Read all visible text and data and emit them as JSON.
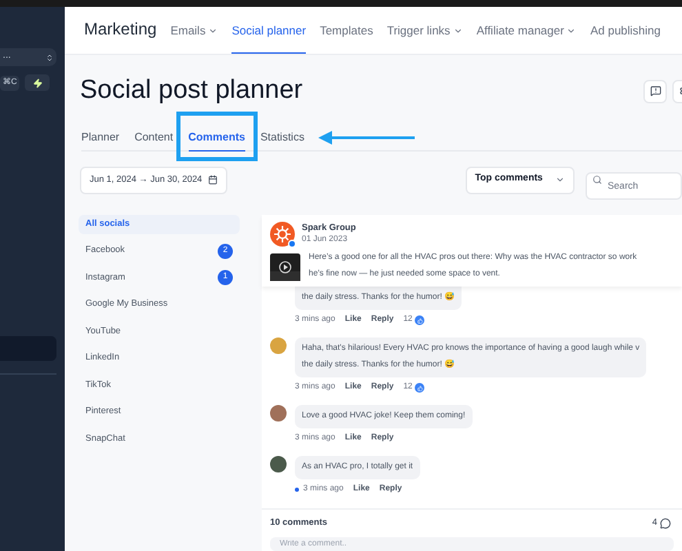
{
  "sidebar": {
    "workspace_field": {
      "value": "..."
    },
    "shortcut": "⌘C"
  },
  "nav": {
    "title": "Marketing",
    "items": [
      {
        "label": "Emails",
        "dropdown": true,
        "selected": false
      },
      {
        "label": "Social planner",
        "dropdown": false,
        "selected": true
      },
      {
        "label": "Templates",
        "dropdown": false,
        "selected": false
      },
      {
        "label": "Trigger links",
        "dropdown": true,
        "selected": false
      },
      {
        "label": "Affiliate manager",
        "dropdown": true,
        "selected": false
      },
      {
        "label": "Ad publishing",
        "dropdown": false,
        "selected": false
      }
    ]
  },
  "page": {
    "title": "Social post planner"
  },
  "tabs": [
    {
      "label": "Planner",
      "selected": false,
      "highlighted": false
    },
    {
      "label": "Content",
      "selected": false,
      "highlighted": false
    },
    {
      "label": "Comments",
      "selected": true,
      "highlighted": true
    },
    {
      "label": "Statistics",
      "selected": false,
      "highlighted": false
    }
  ],
  "date_range": "Jun 1, 2024 → Jun 30, 2024",
  "sort": "Top comments",
  "search": {
    "placeholder": "Search"
  },
  "socials": [
    {
      "label": "All socials",
      "selected": true
    },
    {
      "label": "Facebook",
      "count": "2",
      "selected": false
    },
    {
      "label": "Instagram",
      "count": "1",
      "selected": false
    },
    {
      "label": "Google My Business",
      "selected": false
    },
    {
      "label": "YouTube",
      "selected": false
    },
    {
      "label": "LinkedIn",
      "selected": false
    },
    {
      "label": "TikTok",
      "selected": false
    },
    {
      "label": "Pinterest",
      "selected": false
    },
    {
      "label": "SnapChat",
      "selected": false
    }
  ],
  "post": {
    "author": "Spark Group",
    "date": "01 Jun 2023",
    "text_lines": [
      "Here’s a good one for all the HVAC pros out there: Why was the HVAC contractor so work",
      "he’s fine now — he just needed some space to vent."
    ]
  },
  "comments": [
    {
      "text_lines": [
        "the daily stress. Thanks for the humor! 😅"
      ],
      "time": "3 mins ago",
      "like": "Like",
      "reply": "Reply",
      "reactions": "12",
      "unread": false
    },
    {
      "text_lines": [
        "Haha, that's hilarious! Every HVAC pro knows the importance of having a good laugh while v",
        "the daily stress. Thanks for the humor! 😅"
      ],
      "time": "3 mins ago",
      "like": "Like",
      "reply": "Reply",
      "reactions": "12",
      "unread": false
    },
    {
      "text_lines": [
        "Love a good HVAC joke! Keep them coming!"
      ],
      "time": "3 mins ago",
      "like": "Like",
      "reply": "Reply",
      "unread": false
    },
    {
      "text_lines": [
        "As an HVAC pro, I totally get it"
      ],
      "time": "3 mins ago",
      "like": "Like",
      "reply": "Reply",
      "unread": true
    }
  ],
  "footer": {
    "count": "10 comments",
    "reply_count": "4",
    "composer": {
      "placeholder": "Write a comment.."
    }
  }
}
